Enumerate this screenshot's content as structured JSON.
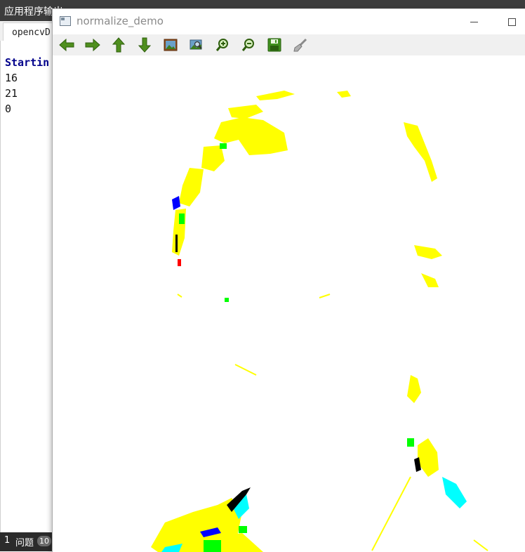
{
  "ide": {
    "title": "应用程序输出",
    "tab_label": "opencvD",
    "output": {
      "starting_text": "Startin",
      "lines": [
        "16",
        "21",
        "0"
      ]
    },
    "status": {
      "count": "1",
      "label": "问题",
      "badge": "10"
    }
  },
  "window": {
    "title": "normalize_demo"
  },
  "toolbar": {
    "buttons": [
      {
        "name": "pan-left",
        "icon": "arrow-left-icon"
      },
      {
        "name": "pan-right",
        "icon": "arrow-right-icon"
      },
      {
        "name": "pan-up",
        "icon": "arrow-up-icon"
      },
      {
        "name": "pan-down",
        "icon": "arrow-down-icon"
      },
      {
        "name": "zoom-reset",
        "icon": "image-icon"
      },
      {
        "name": "zoom-fit",
        "icon": "zoom-image-icon"
      },
      {
        "name": "zoom-in",
        "icon": "zoom-in-icon"
      },
      {
        "name": "zoom-out",
        "icon": "zoom-out-icon"
      },
      {
        "name": "save",
        "icon": "floppy-disk-icon"
      },
      {
        "name": "properties",
        "icon": "brush-icon"
      }
    ]
  },
  "colors": {
    "toolbar_green": "#4f8f1e",
    "yellow": "#ffff00",
    "green": "#00ff00",
    "cyan": "#00ffff",
    "blue": "#0000ff",
    "red": "#ff0000"
  }
}
